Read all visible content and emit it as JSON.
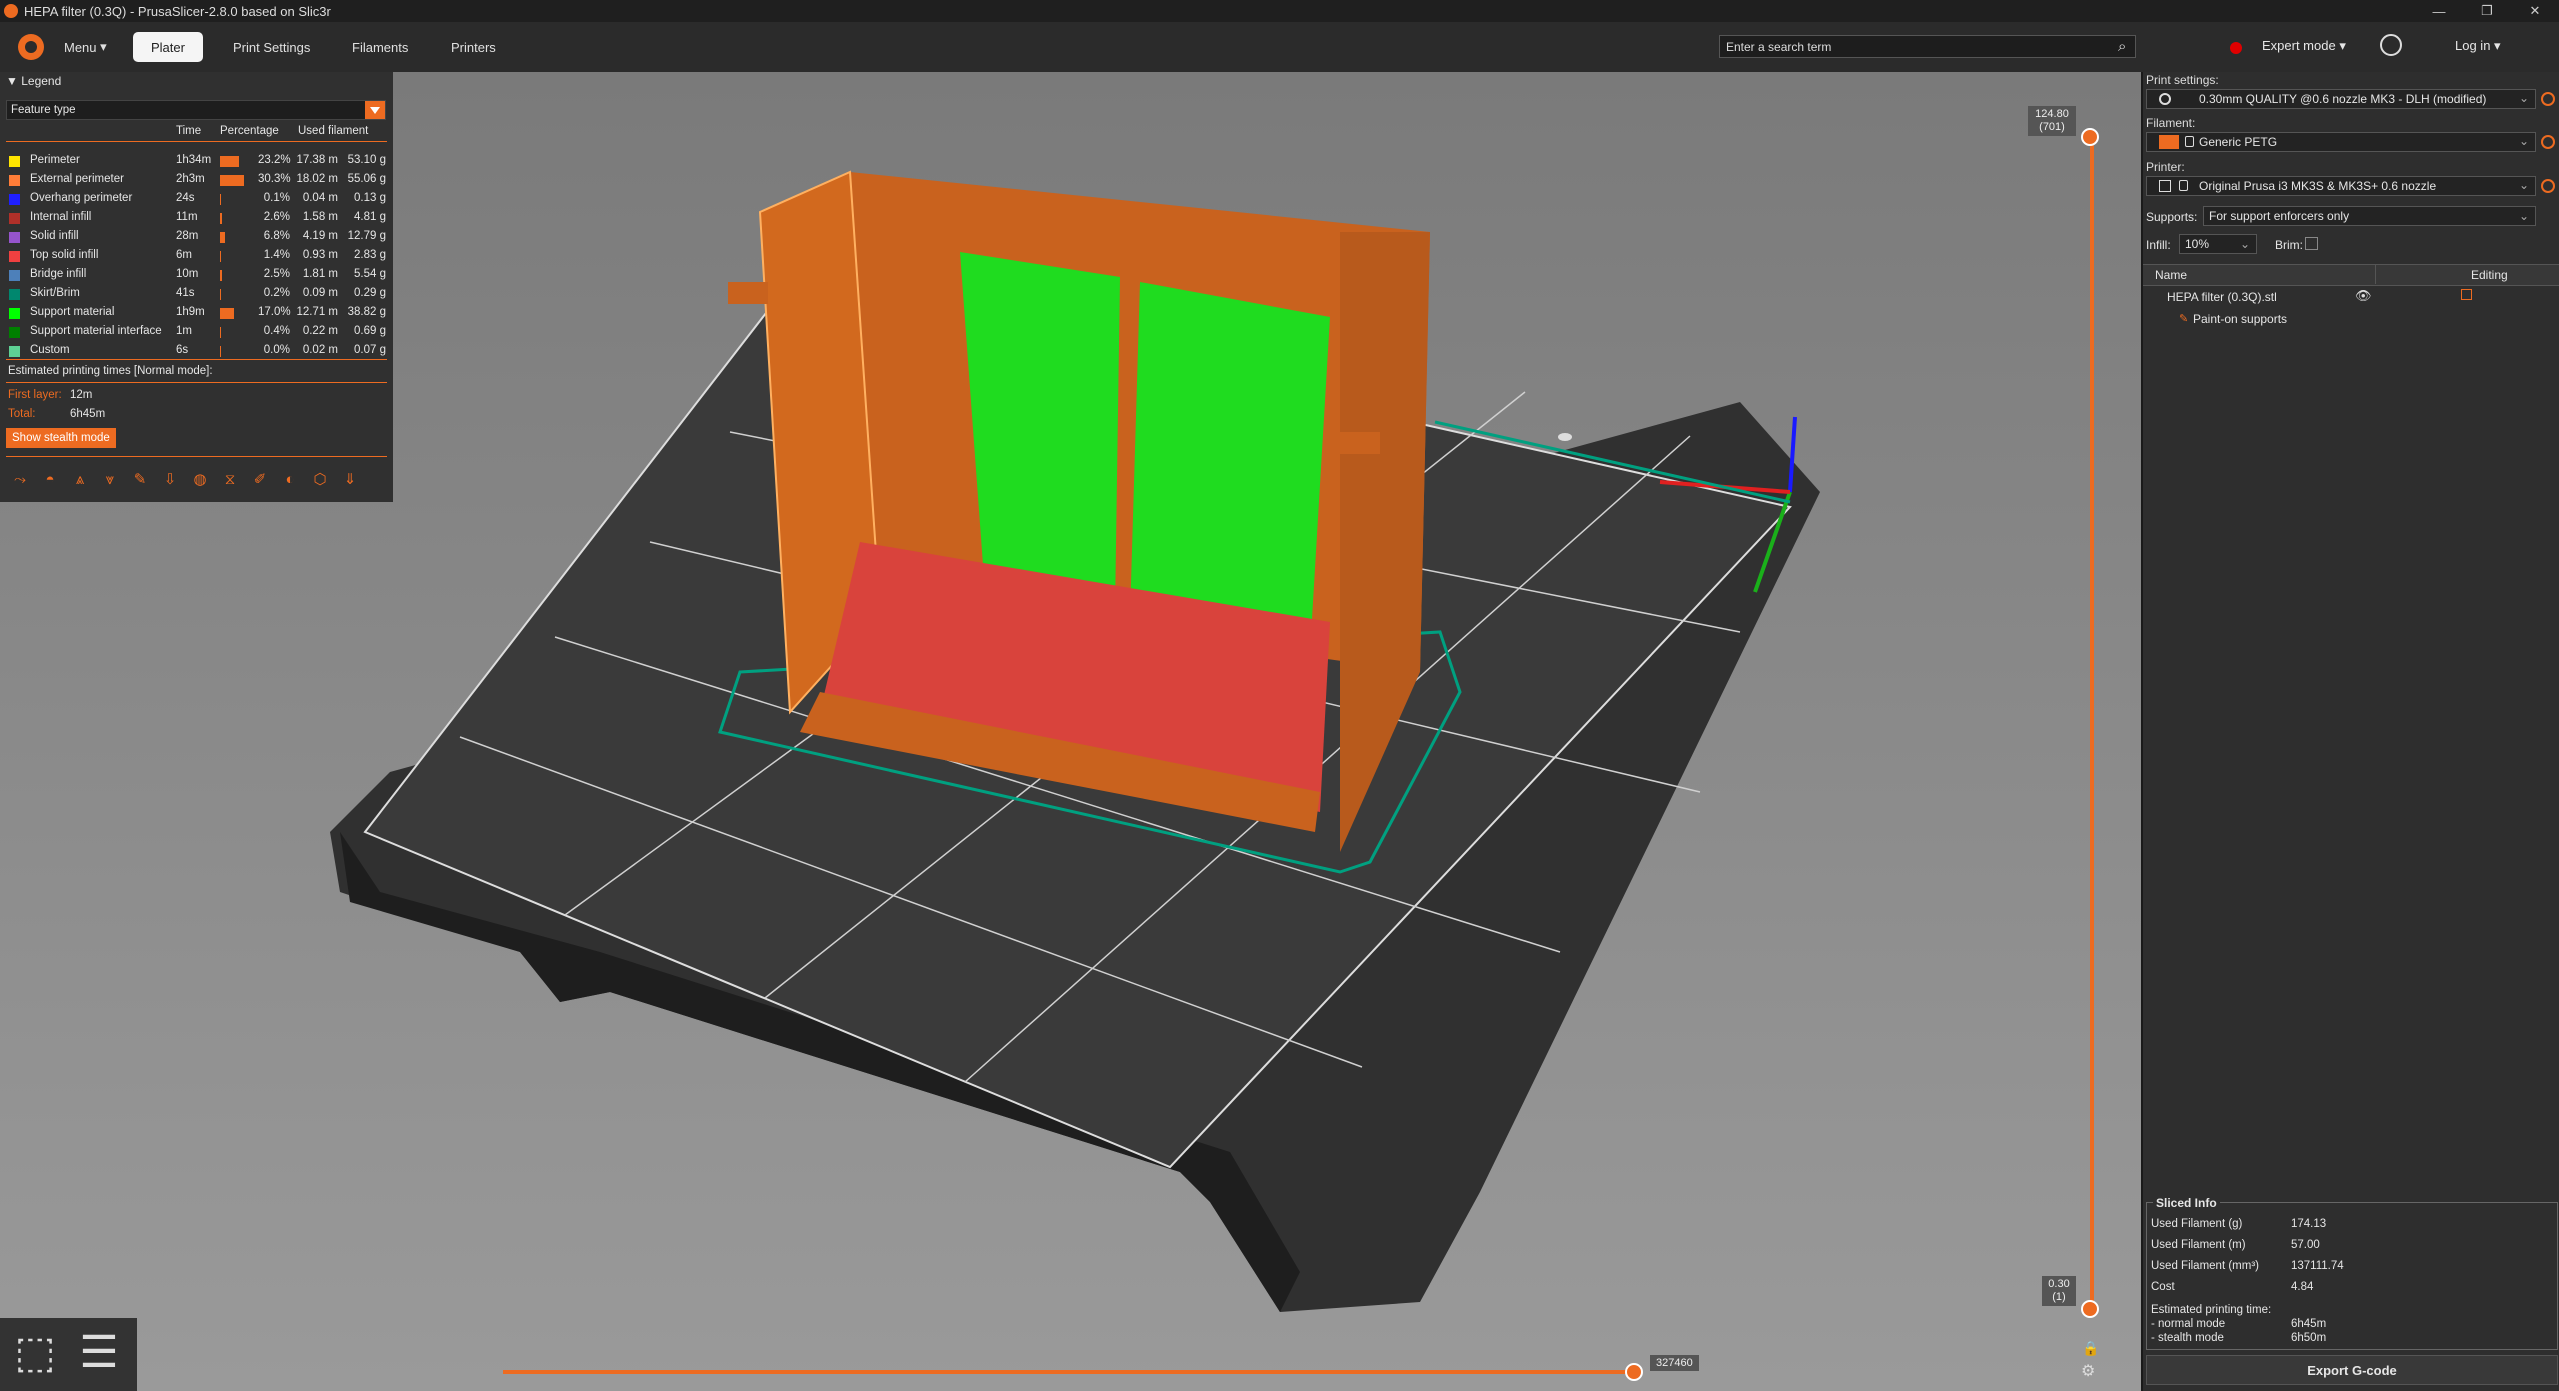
{
  "window": {
    "title": "HEPA filter (0.3Q) - PrusaSlicer-2.8.0 based on Slic3r",
    "controls": [
      "—",
      "❐",
      "✕"
    ]
  },
  "topbar": {
    "menu": "Menu",
    "tabs": [
      {
        "label": "Plater",
        "active": true
      },
      {
        "label": "Print Settings",
        "active": false
      },
      {
        "label": "Filaments",
        "active": false
      },
      {
        "label": "Printers",
        "active": false
      }
    ],
    "search_placeholder": "Enter a search term",
    "mode": "Expert mode",
    "mode_color": "#e00000",
    "login": "Log in"
  },
  "legend": {
    "title": "Legend",
    "view_type": "Feature type",
    "columns": {
      "time": "Time",
      "percentage": "Percentage",
      "used": "Used filament"
    },
    "rows": [
      {
        "name": "Perimeter",
        "color": "#ffe500",
        "time": "1h34m",
        "pct": "23.2%",
        "pct_value": 23.2,
        "m": "17.38 m",
        "g": "53.10 g"
      },
      {
        "name": "External perimeter",
        "color": "#ff7d38",
        "time": "2h3m",
        "pct": "30.3%",
        "pct_value": 30.3,
        "m": "18.02 m",
        "g": "55.06 g"
      },
      {
        "name": "Overhang perimeter",
        "color": "#1f1fff",
        "time": "24s",
        "pct": "0.1%",
        "pct_value": 0.1,
        "m": "0.04 m",
        "g": "0.13 g"
      },
      {
        "name": "Internal infill",
        "color": "#b03029",
        "time": "11m",
        "pct": "2.6%",
        "pct_value": 2.6,
        "m": "1.58 m",
        "g": "4.81 g"
      },
      {
        "name": "Solid infill",
        "color": "#9654cc",
        "time": "28m",
        "pct": "6.8%",
        "pct_value": 6.8,
        "m": "4.19 m",
        "g": "12.79 g"
      },
      {
        "name": "Top solid infill",
        "color": "#f04040",
        "time": "6m",
        "pct": "1.4%",
        "pct_value": 1.4,
        "m": "0.93 m",
        "g": "2.83 g"
      },
      {
        "name": "Bridge infill",
        "color": "#4d80ba",
        "time": "10m",
        "pct": "2.5%",
        "pct_value": 2.5,
        "m": "1.81 m",
        "g": "5.54 g"
      },
      {
        "name": "Skirt/Brim",
        "color": "#00876e",
        "time": "41s",
        "pct": "0.2%",
        "pct_value": 0.2,
        "m": "0.09 m",
        "g": "0.29 g"
      },
      {
        "name": "Support material",
        "color": "#00ff00",
        "time": "1h9m",
        "pct": "17.0%",
        "pct_value": 17.0,
        "m": "12.71 m",
        "g": "38.82 g"
      },
      {
        "name": "Support material interface",
        "color": "#008000",
        "time": "1m",
        "pct": "0.4%",
        "pct_value": 0.4,
        "m": "0.22 m",
        "g": "0.69 g"
      },
      {
        "name": "Custom",
        "color": "#5ed194",
        "time": "6s",
        "pct": "0.0%",
        "pct_value": 0.0,
        "m": "0.02 m",
        "g": "0.07 g"
      }
    ],
    "estimated": "Estimated printing times [Normal mode]:",
    "first_layer_label": "First layer:",
    "first_layer": "12m",
    "total_label": "Total:",
    "total": "6h45m",
    "stealth_button": "Show stealth mode"
  },
  "sliders": {
    "top_label_line1": "124.80",
    "top_label_line2": "(701)",
    "bottom_label_line1": "0.30",
    "bottom_label_line2": "(1)",
    "horizontal_label": "327460"
  },
  "panel": {
    "print_settings_label": "Print settings:",
    "print_settings": "0.30mm QUALITY @0.6 nozzle MK3 - DLH (modified)",
    "filament_label": "Filament:",
    "filament": "Generic PETG",
    "filament_color": "#ed6b21",
    "printer_label": "Printer:",
    "printer": "Original Prusa i3 MK3S & MK3S+ 0.6 nozzle",
    "supports_label": "Supports:",
    "supports": "For support enforcers only",
    "infill_label": "Infill:",
    "infill": "10%",
    "brim_label": "Brim:",
    "objects_name_header": "Name",
    "objects_edit_header": "Editing",
    "object": "HEPA filter (0.3Q).stl",
    "object_sub": "Paint-on supports",
    "sliced_info_title": "Sliced Info",
    "sliced_info": [
      {
        "k": "Used Filament (g)",
        "v": "174.13"
      },
      {
        "k": "Used Filament (m)",
        "v": "57.00"
      },
      {
        "k": "Used Filament (mm³)",
        "v": "137111.74"
      },
      {
        "k": "Cost",
        "v": "4.84"
      },
      {
        "k": "Estimated printing time:",
        "v": ""
      },
      {
        "k": "- normal mode",
        "v": "6h45m"
      },
      {
        "k": "- stealth mode",
        "v": "6h50m"
      }
    ],
    "export_button": "Export G-code"
  }
}
